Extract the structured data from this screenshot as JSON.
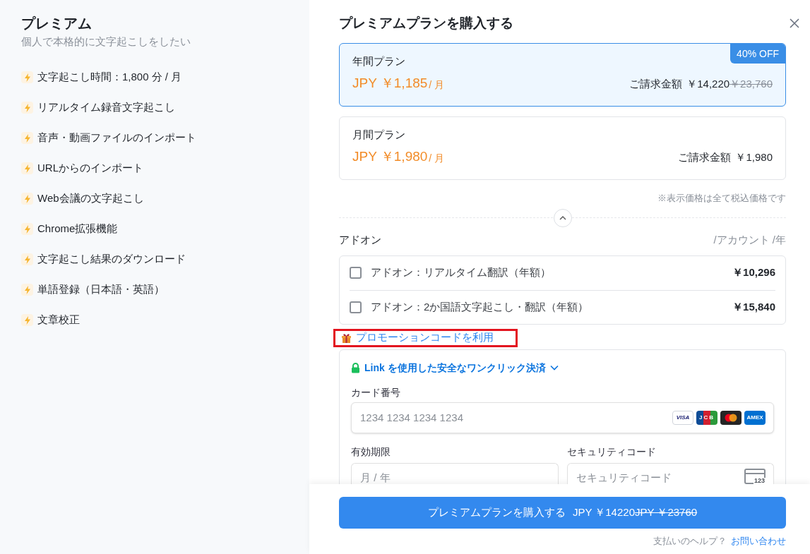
{
  "plan_summary": {
    "title": "プレミアム",
    "subtitle": "個人で本格的に文字起こしをしたい",
    "features": [
      "文字起こし時間：1,800 分 / 月",
      "リアルタイム録音文字起こし",
      "音声・動画ファイルのインポート",
      "URLからのインポート",
      "Web会議の文字起こし",
      "Chrome拡張機能",
      "文字起こし結果のダウンロード",
      "単語登録（日本語・英語）",
      "文章校正"
    ]
  },
  "dialog": {
    "title": "プレミアムプランを購入する",
    "plans": [
      {
        "name": "年間プラン",
        "price": "JPY ￥1,185",
        "unit": "/ 月",
        "billing_label": "ご請求金額",
        "billing_amount": "￥14,220",
        "original_amount": "￥23,760",
        "badge": "40% OFF",
        "selected": true
      },
      {
        "name": "月間プラン",
        "price": "JPY ￥1,980",
        "unit": "/ 月",
        "billing_label": "ご請求金額",
        "billing_amount": "￥1,980",
        "selected": false
      }
    ],
    "tax_note": "※表示価格は全て税込価格です",
    "addons": {
      "title": "アドオン",
      "unit": "/アカウント /年",
      "items": [
        {
          "label": "アドオン：リアルタイム翻訳（年額）",
          "price": "￥10,296",
          "checked": false
        },
        {
          "label": "アドオン：2か国語文字起こし・翻訳（年額）",
          "price": "￥15,840",
          "checked": false
        }
      ]
    },
    "promo": {
      "label": "プロモーションコードを利用",
      "highlighted": true
    },
    "payment": {
      "link_label": "Link を使用した安全なワンクリック決済",
      "card_number": {
        "label": "カード番号",
        "placeholder": "1234 1234 1234 1234"
      },
      "card_brands": [
        {
          "kind": "visa",
          "label": "VISA"
        },
        {
          "kind": "jcb",
          "label": "JCB"
        },
        {
          "kind": "mastercard"
        },
        {
          "kind": "amex",
          "label": "AMEX"
        }
      ],
      "expiry": {
        "label": "有効期限",
        "placeholder": "月 / 年"
      },
      "cvc": {
        "label": "セキュリティコード",
        "placeholder": "セキュリティコード",
        "icon_text": "123"
      }
    },
    "purchase_button": {
      "label": "プレミアムプランを購入する",
      "price": "JPY ￥14220",
      "original_price": "JPY ￥23760"
    },
    "help": {
      "text": "支払いのヘルプ？",
      "link": "お問い合わせ"
    }
  }
}
